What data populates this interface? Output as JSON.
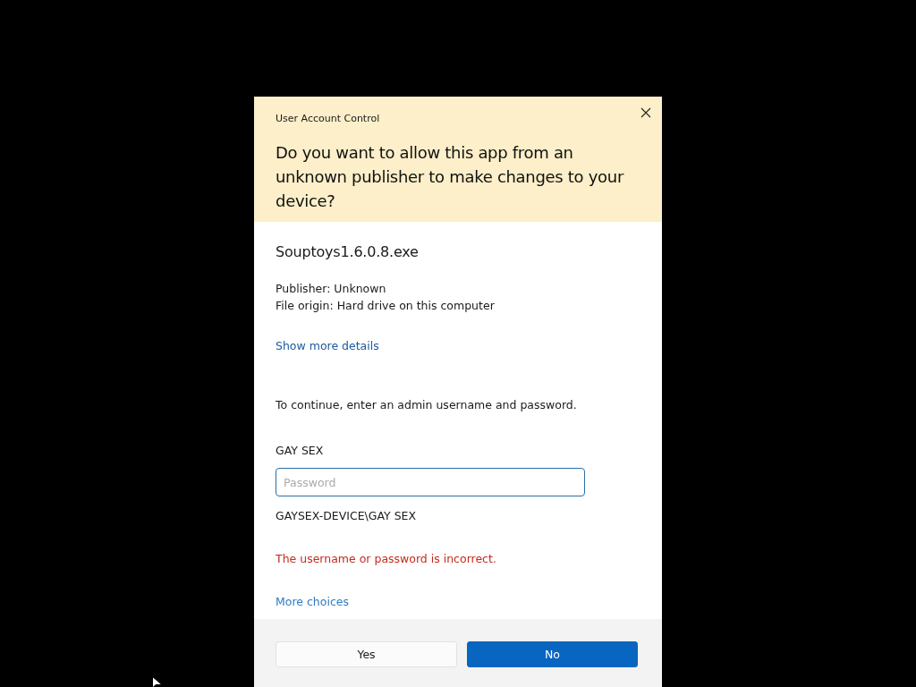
{
  "dialog": {
    "title": "User Account Control",
    "question": "Do you want to allow this app from an unknown publisher to make changes to your device?"
  },
  "app": {
    "name": "Souptoys1.6.0.8.exe",
    "publisher": "Publisher: Unknown",
    "origin": "File origin: Hard drive on this computer",
    "details_link": "Show more details"
  },
  "credentials": {
    "prompt": "To continue, enter an admin username and password.",
    "username": "GAY SEX",
    "password": {
      "placeholder": "Password"
    },
    "account": "GAYSEX-DEVICE\\GAY SEX",
    "error": "The username or password is incorrect.",
    "more_link": "More choices"
  },
  "buttons": [
    {
      "label": "Yes",
      "kind": "secondary"
    },
    {
      "label": "No",
      "kind": "primary"
    }
  ]
}
